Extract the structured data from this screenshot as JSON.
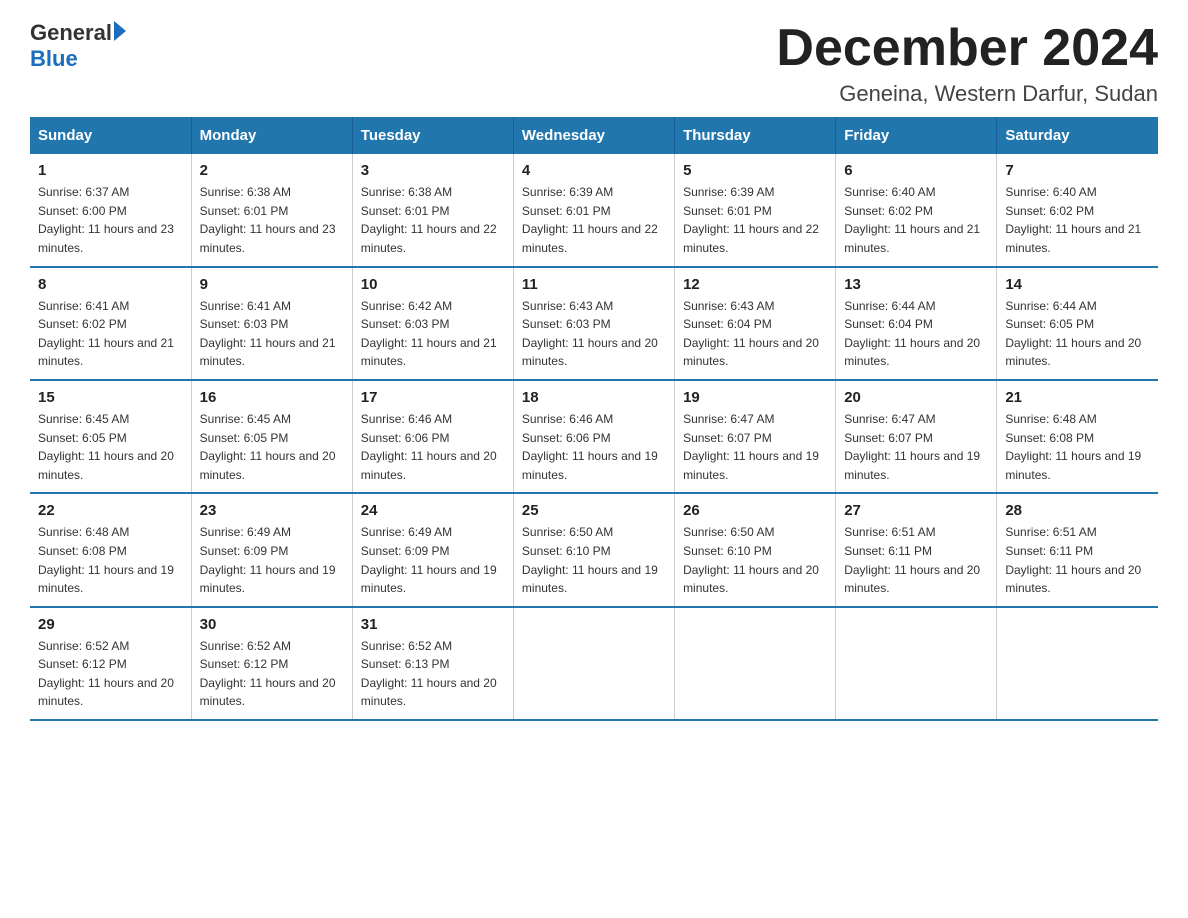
{
  "logo": {
    "general": "General",
    "blue": "Blue"
  },
  "title": "December 2024",
  "subtitle": "Geneina, Western Darfur, Sudan",
  "days_of_week": [
    "Sunday",
    "Monday",
    "Tuesday",
    "Wednesday",
    "Thursday",
    "Friday",
    "Saturday"
  ],
  "weeks": [
    [
      {
        "day": "1",
        "sunrise": "6:37 AM",
        "sunset": "6:00 PM",
        "daylight": "11 hours and 23 minutes."
      },
      {
        "day": "2",
        "sunrise": "6:38 AM",
        "sunset": "6:01 PM",
        "daylight": "11 hours and 23 minutes."
      },
      {
        "day": "3",
        "sunrise": "6:38 AM",
        "sunset": "6:01 PM",
        "daylight": "11 hours and 22 minutes."
      },
      {
        "day": "4",
        "sunrise": "6:39 AM",
        "sunset": "6:01 PM",
        "daylight": "11 hours and 22 minutes."
      },
      {
        "day": "5",
        "sunrise": "6:39 AM",
        "sunset": "6:01 PM",
        "daylight": "11 hours and 22 minutes."
      },
      {
        "day": "6",
        "sunrise": "6:40 AM",
        "sunset": "6:02 PM",
        "daylight": "11 hours and 21 minutes."
      },
      {
        "day": "7",
        "sunrise": "6:40 AM",
        "sunset": "6:02 PM",
        "daylight": "11 hours and 21 minutes."
      }
    ],
    [
      {
        "day": "8",
        "sunrise": "6:41 AM",
        "sunset": "6:02 PM",
        "daylight": "11 hours and 21 minutes."
      },
      {
        "day": "9",
        "sunrise": "6:41 AM",
        "sunset": "6:03 PM",
        "daylight": "11 hours and 21 minutes."
      },
      {
        "day": "10",
        "sunrise": "6:42 AM",
        "sunset": "6:03 PM",
        "daylight": "11 hours and 21 minutes."
      },
      {
        "day": "11",
        "sunrise": "6:43 AM",
        "sunset": "6:03 PM",
        "daylight": "11 hours and 20 minutes."
      },
      {
        "day": "12",
        "sunrise": "6:43 AM",
        "sunset": "6:04 PM",
        "daylight": "11 hours and 20 minutes."
      },
      {
        "day": "13",
        "sunrise": "6:44 AM",
        "sunset": "6:04 PM",
        "daylight": "11 hours and 20 minutes."
      },
      {
        "day": "14",
        "sunrise": "6:44 AM",
        "sunset": "6:05 PM",
        "daylight": "11 hours and 20 minutes."
      }
    ],
    [
      {
        "day": "15",
        "sunrise": "6:45 AM",
        "sunset": "6:05 PM",
        "daylight": "11 hours and 20 minutes."
      },
      {
        "day": "16",
        "sunrise": "6:45 AM",
        "sunset": "6:05 PM",
        "daylight": "11 hours and 20 minutes."
      },
      {
        "day": "17",
        "sunrise": "6:46 AM",
        "sunset": "6:06 PM",
        "daylight": "11 hours and 20 minutes."
      },
      {
        "day": "18",
        "sunrise": "6:46 AM",
        "sunset": "6:06 PM",
        "daylight": "11 hours and 19 minutes."
      },
      {
        "day": "19",
        "sunrise": "6:47 AM",
        "sunset": "6:07 PM",
        "daylight": "11 hours and 19 minutes."
      },
      {
        "day": "20",
        "sunrise": "6:47 AM",
        "sunset": "6:07 PM",
        "daylight": "11 hours and 19 minutes."
      },
      {
        "day": "21",
        "sunrise": "6:48 AM",
        "sunset": "6:08 PM",
        "daylight": "11 hours and 19 minutes."
      }
    ],
    [
      {
        "day": "22",
        "sunrise": "6:48 AM",
        "sunset": "6:08 PM",
        "daylight": "11 hours and 19 minutes."
      },
      {
        "day": "23",
        "sunrise": "6:49 AM",
        "sunset": "6:09 PM",
        "daylight": "11 hours and 19 minutes."
      },
      {
        "day": "24",
        "sunrise": "6:49 AM",
        "sunset": "6:09 PM",
        "daylight": "11 hours and 19 minutes."
      },
      {
        "day": "25",
        "sunrise": "6:50 AM",
        "sunset": "6:10 PM",
        "daylight": "11 hours and 19 minutes."
      },
      {
        "day": "26",
        "sunrise": "6:50 AM",
        "sunset": "6:10 PM",
        "daylight": "11 hours and 20 minutes."
      },
      {
        "day": "27",
        "sunrise": "6:51 AM",
        "sunset": "6:11 PM",
        "daylight": "11 hours and 20 minutes."
      },
      {
        "day": "28",
        "sunrise": "6:51 AM",
        "sunset": "6:11 PM",
        "daylight": "11 hours and 20 minutes."
      }
    ],
    [
      {
        "day": "29",
        "sunrise": "6:52 AM",
        "sunset": "6:12 PM",
        "daylight": "11 hours and 20 minutes."
      },
      {
        "day": "30",
        "sunrise": "6:52 AM",
        "sunset": "6:12 PM",
        "daylight": "11 hours and 20 minutes."
      },
      {
        "day": "31",
        "sunrise": "6:52 AM",
        "sunset": "6:13 PM",
        "daylight": "11 hours and 20 minutes."
      },
      null,
      null,
      null,
      null
    ]
  ]
}
